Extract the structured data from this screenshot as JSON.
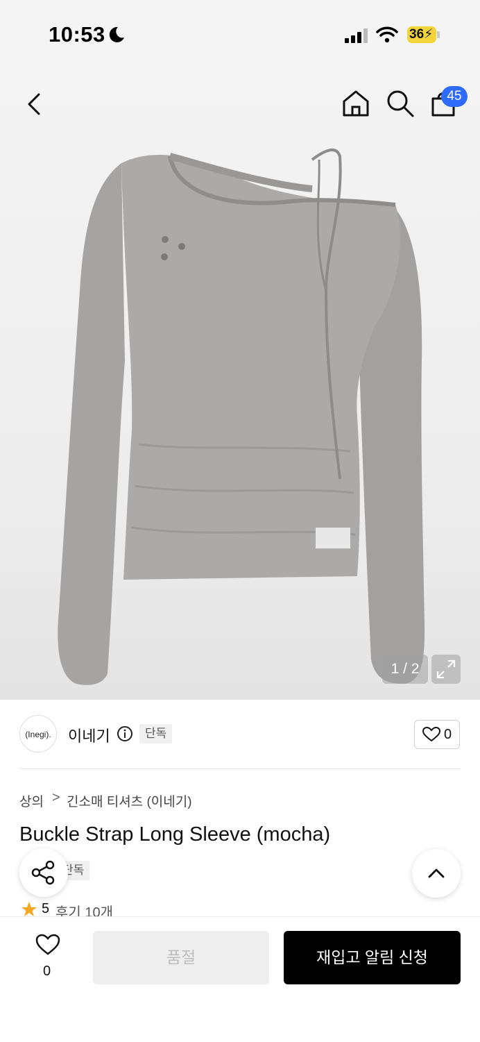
{
  "status_bar": {
    "time": "10:53",
    "battery": "36"
  },
  "header": {
    "cart_count": "45"
  },
  "gallery": {
    "page_indicator": "1 / 2"
  },
  "brand": {
    "logo_text": "(Inegi).",
    "name": "이네기",
    "badge": "단독",
    "like_count": "0"
  },
  "breadcrumb": {
    "level1": "상의",
    "separator": ">",
    "level2": "긴소매 티셔츠 (이네기)"
  },
  "product": {
    "title": "Buckle Strap Long Sleeve (mocha)",
    "tag": "단독",
    "rating": "5",
    "reviews": "후기 10개"
  },
  "bottom_bar": {
    "wish_count": "0",
    "soldout_label": "품절",
    "restock_label": "재입고 알림 신청"
  },
  "colors": {
    "accent": "#2f6bff",
    "star": "#f5a623",
    "garment": "#a9a7a5"
  }
}
